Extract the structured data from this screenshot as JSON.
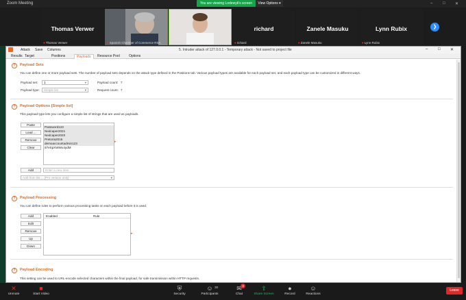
{
  "zoom": {
    "window_title": "Zoom Meeting",
    "share_banner": "You are viewing Lodewyk's screen",
    "view_options": "View Options ▾",
    "controls": [
      "–",
      "□",
      "✕"
    ],
    "participants": [
      {
        "big": "Thomas Verwer",
        "small": "Thomas Verwer"
      },
      {
        "big": "",
        "small": "Spanish Chamber of Commerce RSA"
      },
      {
        "big": "",
        "small": "Lodewyk"
      },
      {
        "big": "richard",
        "small": "richard"
      },
      {
        "big": "Zanele Masuku",
        "small": "Zanele Masuku"
      },
      {
        "big": "Lynn Rubix",
        "small": "Lynn Rubix"
      }
    ],
    "next_glyph": "❯"
  },
  "burp": {
    "menu": [
      "Attack",
      "Save",
      "Columns"
    ],
    "window_title": "5. Intruder attack of 127.0.0.1 - Temporary attack - Not saved to project file",
    "tabs": [
      "Results",
      "Target",
      "Positions",
      "Payloads",
      "Resource Pool",
      "Options"
    ],
    "active_tab": "Payloads",
    "payload_sets": {
      "title": "Payload Sets",
      "desc": "You can define one or more payload sets. The number of payload sets depends on the attack type defined in the Positions tab. Various payload types are available for each payload set, and each payload type can be customized in different ways.",
      "set_label": "Payload set:",
      "set_value": "1",
      "type_label": "Payload type:",
      "type_value": "Simple list",
      "count_label": "Payload count:",
      "count_value": "7",
      "request_label": "Request count:",
      "request_value": "7"
    },
    "payload_options": {
      "title": "Payload Options [Simple list]",
      "desc": "This payload type lets you configure a simple list of strings that are used as payloads.",
      "buttons": [
        "Paste",
        "Load ...",
        "Remove",
        "Clear"
      ],
      "items": [
        "Password123",
        "Nedcaper2021",
        "Nedcaper2020",
        "Pretoria2015",
        "demoaccountadmin123",
        "57eSpXWWx4ydM"
      ],
      "add_label": "Add",
      "add_placeholder": "Enter a new item",
      "addlist_value": "Add from list ... [Pro version only]"
    },
    "payload_processing": {
      "title": "Payload Processing",
      "desc": "You can define rules to perform various processing tasks on each payload before it is used.",
      "buttons": [
        "Add",
        "Edit",
        "Remove",
        "Up",
        "Down"
      ],
      "columns": [
        "Enabled",
        "Rule"
      ]
    },
    "payload_encoding": {
      "title": "Payload Encoding",
      "desc": "This setting can be used to URL-encode selected characters within the final payload, for safe transmission within HTTP requests."
    }
  },
  "toolbar": {
    "items": [
      {
        "label": "Unmute",
        "icon": "✕"
      },
      {
        "label": "Start Video",
        "icon": "■"
      },
      {
        "label": "Security",
        "icon": "⛨"
      },
      {
        "label": "Participants",
        "icon": "☺"
      },
      {
        "label": "Chat",
        "icon": "✉"
      },
      {
        "label": "Share Screen",
        "icon": "⇧"
      },
      {
        "label": "Record",
        "icon": "●"
      },
      {
        "label": "Reactions",
        "icon": "☺"
      }
    ],
    "participants_count": "30",
    "chat_badge": "3",
    "leave": "Leave"
  },
  "colors": {
    "accent": "#e8691f",
    "share_green": "#18a34a",
    "leave_red": "#e02828",
    "zoom_blue": "#2d8cff"
  }
}
